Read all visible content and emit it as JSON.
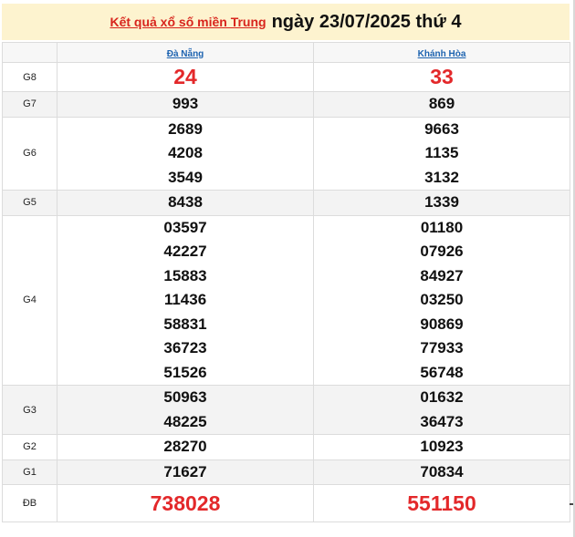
{
  "title": {
    "link_text": "Kết quả xổ số miền Trung",
    "date_text": "ngày 23/07/2025 thứ 4"
  },
  "provinces": [
    "Đà Nẵng",
    "Khánh Hòa"
  ],
  "prizes": [
    {
      "label": "G8",
      "values": [
        [
          "24"
        ],
        [
          "33"
        ]
      ]
    },
    {
      "label": "G7",
      "values": [
        [
          "993"
        ],
        [
          "869"
        ]
      ]
    },
    {
      "label": "G6",
      "values": [
        [
          "2689",
          "4208",
          "3549"
        ],
        [
          "9663",
          "1135",
          "3132"
        ]
      ]
    },
    {
      "label": "G5",
      "values": [
        [
          "8438"
        ],
        [
          "1339"
        ]
      ]
    },
    {
      "label": "G4",
      "values": [
        [
          "03597",
          "42227",
          "15883",
          "11436",
          "58831",
          "36723",
          "51526"
        ],
        [
          "01180",
          "07926",
          "84927",
          "03250",
          "90869",
          "77933",
          "56748"
        ]
      ]
    },
    {
      "label": "G3",
      "values": [
        [
          "50963",
          "48225"
        ],
        [
          "01632",
          "36473"
        ]
      ]
    },
    {
      "label": "G2",
      "values": [
        [
          "28270"
        ],
        [
          "10923"
        ]
      ]
    },
    {
      "label": "G1",
      "values": [
        [
          "71627"
        ],
        [
          "70834"
        ]
      ]
    },
    {
      "label": "ĐB",
      "values": [
        [
          "738028"
        ],
        [
          "551150"
        ]
      ]
    }
  ],
  "colors": {
    "title_background": "#fdf3cf",
    "highlight_red": "#e3282a",
    "link_blue": "#1d63b0"
  }
}
